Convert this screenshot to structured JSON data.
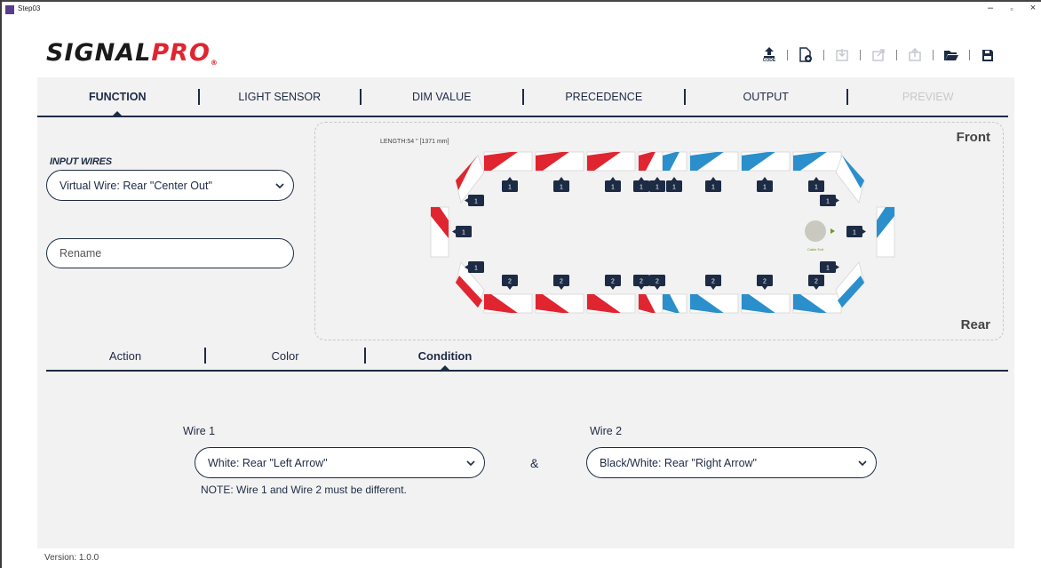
{
  "window": {
    "title": "Step03",
    "minimize": "–",
    "restore": "▫",
    "close": "×"
  },
  "logo": {
    "signal": "SIGNAL",
    "pro": "PRO",
    "reg": "®"
  },
  "toolbar": {
    "upload_code_label": "CODE"
  },
  "main_tabs": [
    {
      "label": "FUNCTION",
      "state": "active"
    },
    {
      "label": "LIGHT SENSOR",
      "state": "normal"
    },
    {
      "label": "DIM VALUE",
      "state": "normal"
    },
    {
      "label": "PRECEDENCE",
      "state": "normal"
    },
    {
      "label": "OUTPUT",
      "state": "normal"
    },
    {
      "label": "PREVIEW",
      "state": "disabled"
    }
  ],
  "input_wires": {
    "label": "INPUT WIRES",
    "selected": "Virtual Wire:  Rear \"Center Out\"",
    "rename_placeholder": "Rename"
  },
  "lightbar": {
    "length_text": "LENGTH:54 \" [1371 mm]",
    "front_label": "Front",
    "rear_label": "Rear",
    "cable_exit_label": "Cable Exit",
    "colors": {
      "red": "#e02530",
      "blue": "#2b8fcc",
      "tag": "#1d2b45"
    },
    "front_modules": [
      {
        "color": "red",
        "tags": [
          "1"
        ]
      },
      {
        "color": "red",
        "tags": [
          "1"
        ]
      },
      {
        "color": "red",
        "tags": [
          "1"
        ]
      },
      {
        "color": "red-blue",
        "tags": [
          "1",
          "1",
          "1"
        ]
      },
      {
        "color": "blue",
        "tags": [
          "1"
        ]
      },
      {
        "color": "blue",
        "tags": [
          "1"
        ]
      },
      {
        "color": "blue",
        "tags": [
          "1"
        ]
      }
    ],
    "rear_modules": [
      {
        "color": "red",
        "tags": [
          "2"
        ]
      },
      {
        "color": "red",
        "tags": [
          "2"
        ]
      },
      {
        "color": "red",
        "tags": [
          "2"
        ]
      },
      {
        "color": "red-blue",
        "tags": [
          "2",
          "2"
        ]
      },
      {
        "color": "blue",
        "tags": [
          "2"
        ]
      },
      {
        "color": "blue",
        "tags": [
          "2"
        ]
      },
      {
        "color": "blue",
        "tags": [
          "2"
        ]
      }
    ],
    "end_tags": [
      "1",
      "1",
      "1",
      "1",
      "1",
      "1"
    ]
  },
  "sub_tabs": [
    {
      "label": "Action",
      "state": "normal"
    },
    {
      "label": "Color",
      "state": "normal"
    },
    {
      "label": "Condition",
      "state": "active"
    }
  ],
  "condition": {
    "wire1_label": "Wire 1",
    "wire1_value": "White:  Rear \"Left Arrow\"",
    "and_symbol": "&",
    "wire2_label": "Wire 2",
    "wire2_value": "Black/White:  Rear \"Right Arrow\"",
    "note": "NOTE: Wire 1 and Wire 2 must be different."
  },
  "version": "Version: 1.0.0"
}
